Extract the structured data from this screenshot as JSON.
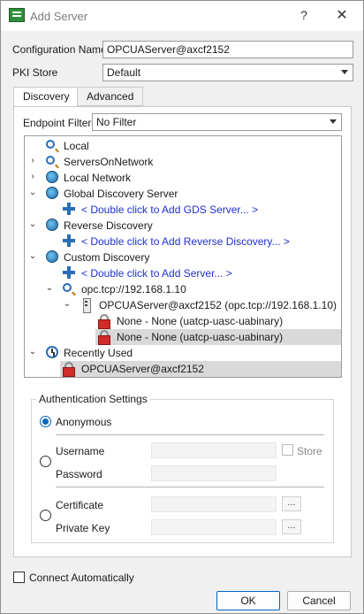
{
  "window": {
    "title": "Add Server",
    "help_glyph": "?",
    "close_glyph": "✕"
  },
  "form": {
    "configuration_name_label": "Configuration Name",
    "configuration_name_value": "OPCUAServer@axcf2152",
    "pki_store_label": "PKI Store",
    "pki_store_value": "Default"
  },
  "tabs": [
    {
      "label": "Discovery",
      "active": true
    },
    {
      "label": "Advanced",
      "active": false
    }
  ],
  "discovery": {
    "endpoint_filter_label": "Endpoint Filter:",
    "endpoint_filter_value": "No Filter"
  },
  "tree": [
    {
      "label": "Local",
      "icon": "search-icon",
      "expander": "",
      "link": false,
      "selected": false
    },
    {
      "label": "ServersOnNetwork",
      "icon": "search-icon",
      "expander": "›",
      "link": false,
      "selected": false
    },
    {
      "label": "Local Network",
      "icon": "globe-icon",
      "expander": "›",
      "link": false,
      "selected": false
    },
    {
      "label": "Global Discovery Server",
      "icon": "globe-icon",
      "expander": "⌄",
      "link": false,
      "selected": false
    },
    {
      "label": "< Double click to Add GDS Server... >",
      "icon": "plus-icon",
      "expander": "",
      "link": true,
      "selected": false
    },
    {
      "label": "Reverse Discovery",
      "icon": "globe-icon",
      "expander": "⌄",
      "link": false,
      "selected": false
    },
    {
      "label": "< Double click to Add Reverse Discovery... >",
      "icon": "plus-icon",
      "expander": "",
      "link": true,
      "selected": false
    },
    {
      "label": "Custom Discovery",
      "icon": "globe-icon",
      "expander": "⌄",
      "link": false,
      "selected": false
    },
    {
      "label": "< Double click to Add Server... >",
      "icon": "plus-icon",
      "expander": "",
      "link": true,
      "selected": false
    },
    {
      "label": "opc.tcp://192.168.1.10",
      "icon": "search-icon",
      "expander": "⌄",
      "link": false,
      "selected": false
    },
    {
      "label": "OPCUAServer@axcf2152 (opc.tcp://192.168.1.10)",
      "icon": "server-icon",
      "expander": "⌄",
      "link": false,
      "selected": false
    },
    {
      "label": "None - None (uatcp-uasc-uabinary)",
      "icon": "lock-icon",
      "expander": "",
      "link": false,
      "selected": false
    },
    {
      "label": "None - None (uatcp-uasc-uabinary)",
      "icon": "lock-icon",
      "expander": "",
      "link": false,
      "selected": true
    },
    {
      "label": "Recently Used",
      "icon": "clock-icon",
      "expander": "⌄",
      "link": false,
      "selected": false
    },
    {
      "label": "OPCUAServer@axcf2152",
      "icon": "lock-icon",
      "expander": "",
      "link": false,
      "selected": true
    }
  ],
  "auth": {
    "title": "Authentication Settings",
    "anonymous_label": "Anonymous",
    "anonymous_selected": true,
    "username_label": "Username",
    "password_label": "Password",
    "store_label": "Store",
    "certificate_label": "Certificate",
    "private_key_label": "Private Key",
    "browse_glyph": "..."
  },
  "footer": {
    "connect_auto_label": "Connect Automatically",
    "ok_label": "OK",
    "cancel_label": "Cancel"
  },
  "colors": {
    "accent": "#0067c0",
    "link": "#1f2fd1",
    "selection": "#d9d9d9"
  }
}
